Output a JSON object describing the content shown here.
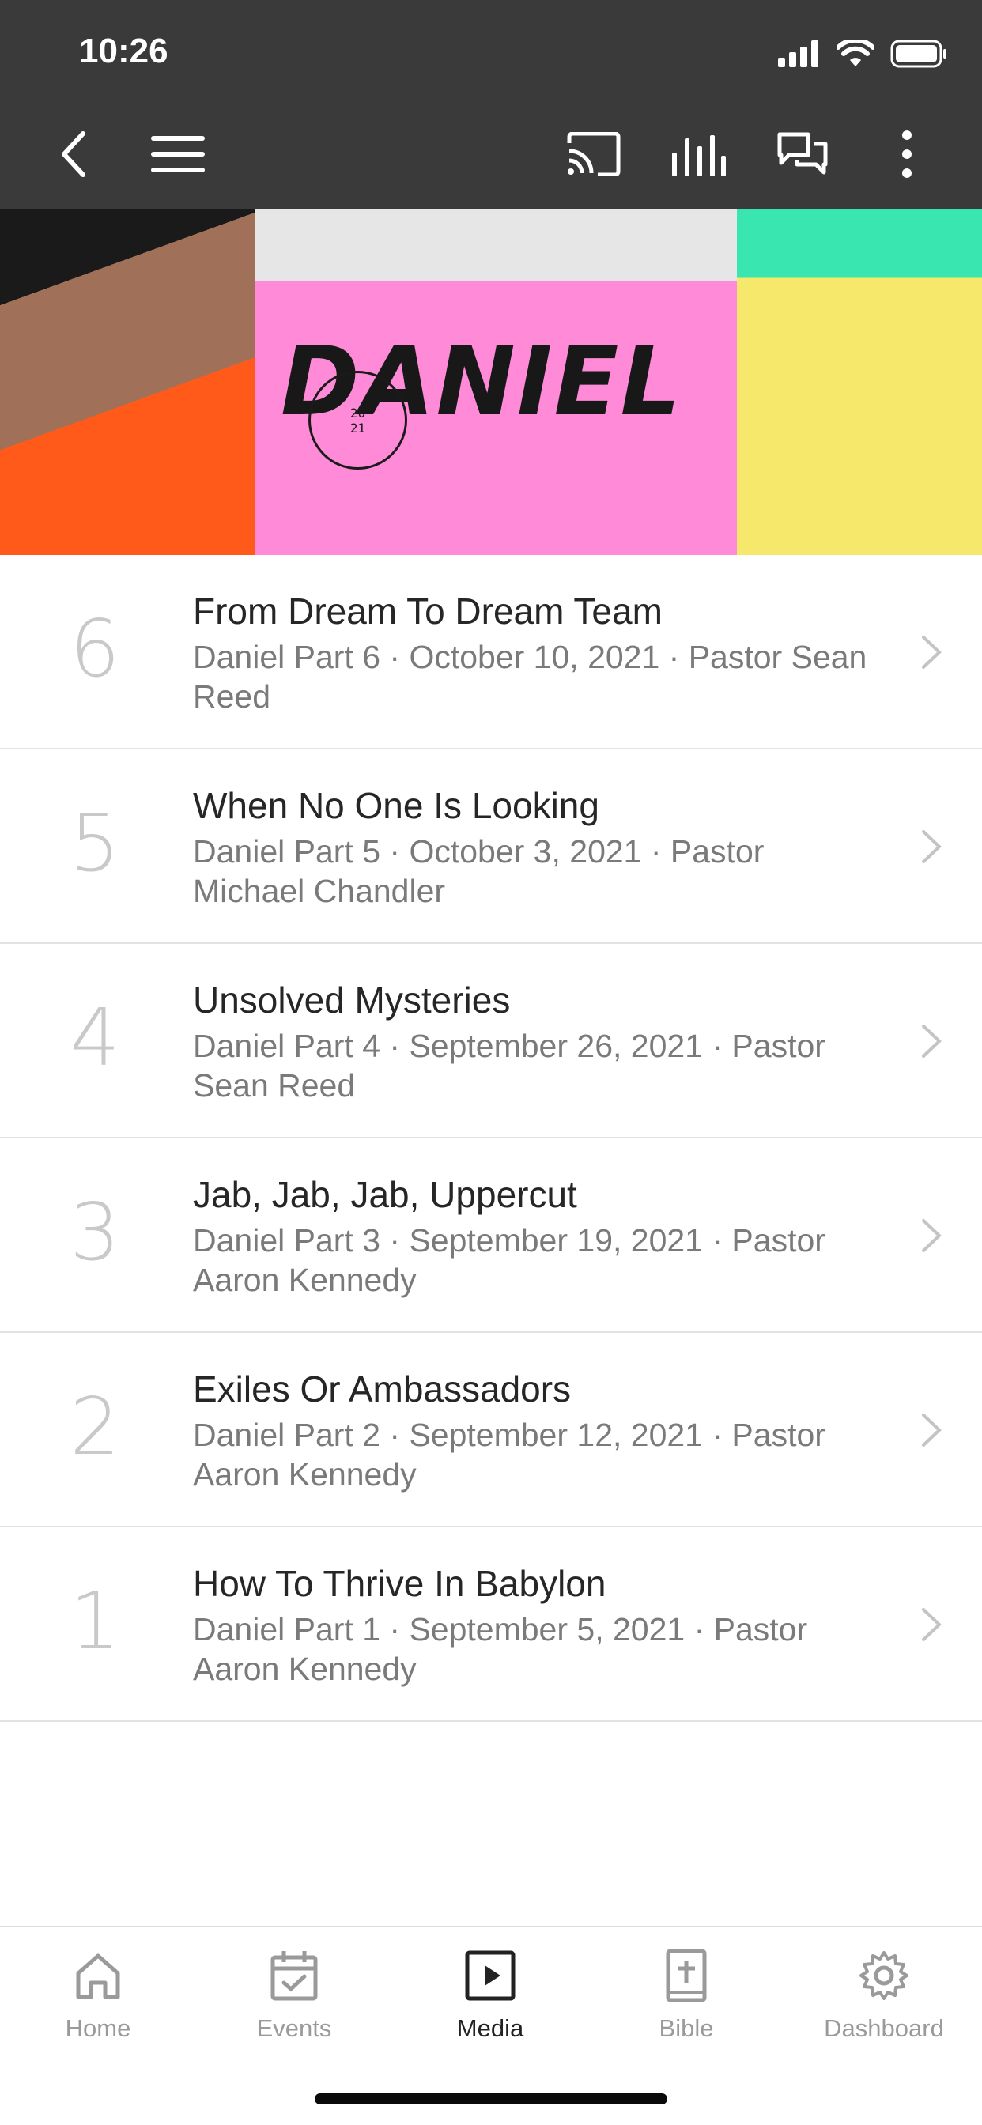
{
  "status_bar": {
    "time": "10:26"
  },
  "appbar": {
    "icons": [
      "back-icon",
      "menu-icon",
      "cast-icon",
      "audio-bars-icon",
      "chat-icon",
      "more-vertical-icon"
    ]
  },
  "banner": {
    "title": "DANIEL",
    "stamp_year": "20\n21"
  },
  "sermons": [
    {
      "number": "6",
      "title": "From Dream To Dream Team",
      "subtitle": "Daniel Part 6 · October 10, 2021 · Pastor Sean Reed"
    },
    {
      "number": "5",
      "title": "When No One Is Looking",
      "subtitle": "Daniel Part 5 · October 3, 2021 · Pastor Michael Chandler"
    },
    {
      "number": "4",
      "title": "Unsolved Mysteries",
      "subtitle": "Daniel Part 4 · September 26, 2021 · Pastor Sean Reed"
    },
    {
      "number": "3",
      "title": "Jab, Jab, Jab, Uppercut",
      "subtitle": "Daniel Part 3 · September 19, 2021 · Pastor Aaron Kennedy"
    },
    {
      "number": "2",
      "title": "Exiles Or Ambassadors",
      "subtitle": "Daniel Part 2 · September 12, 2021 · Pastor Aaron Kennedy"
    },
    {
      "number": "1",
      "title": "How To Thrive In Babylon",
      "subtitle": "Daniel Part 1 · September 5, 2021 · Pastor Aaron Kennedy"
    }
  ],
  "tabbar": {
    "tabs": [
      {
        "label": "Home",
        "icon": "home-icon",
        "active": false
      },
      {
        "label": "Events",
        "icon": "calendar-check-icon",
        "active": false
      },
      {
        "label": "Media",
        "icon": "play-square-icon",
        "active": true
      },
      {
        "label": "Bible",
        "icon": "bible-icon",
        "active": false
      },
      {
        "label": "Dashboard",
        "icon": "gear-icon",
        "active": false
      }
    ]
  },
  "colors": {
    "header_bg": "#3a3a3a",
    "tab_active": "#222222",
    "tab_inactive": "#9a9a9a"
  }
}
